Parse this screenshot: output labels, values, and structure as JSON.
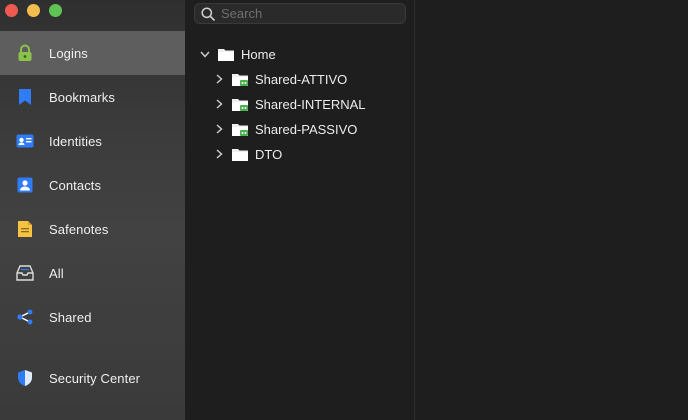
{
  "window": {
    "controls": [
      "close",
      "minimize",
      "zoom"
    ]
  },
  "sidebar": {
    "items": [
      {
        "label": "Logins",
        "icon": "lock-icon",
        "selected": true
      },
      {
        "label": "Bookmarks",
        "icon": "bookmark-icon"
      },
      {
        "label": "Identities",
        "icon": "id-card-icon"
      },
      {
        "label": "Contacts",
        "icon": "contact-card-icon"
      },
      {
        "label": "Safenotes",
        "icon": "note-icon"
      },
      {
        "label": "All",
        "icon": "inbox-tray-icon"
      },
      {
        "label": "Shared",
        "icon": "share-icon"
      },
      {
        "label": "Security Center",
        "icon": "shield-icon"
      }
    ]
  },
  "search": {
    "placeholder": "Search",
    "value": ""
  },
  "tree": {
    "root": {
      "label": "Home",
      "expanded": true
    },
    "children": [
      {
        "label": "Shared-ATTIVO",
        "shared": true,
        "expanded": false
      },
      {
        "label": "Shared-INTERNAL",
        "shared": true,
        "expanded": false
      },
      {
        "label": "Shared-PASSIVO",
        "shared": true,
        "expanded": false
      },
      {
        "label": "DTO",
        "shared": false,
        "expanded": false
      }
    ]
  },
  "colors": {
    "accent_blue": "#2f7cf6",
    "lock_green": "#8bc34a",
    "safenote_yellow": "#f5c242",
    "shared_badge_green": "#4caf50",
    "sidebar_selected": "#5e5e5e"
  }
}
